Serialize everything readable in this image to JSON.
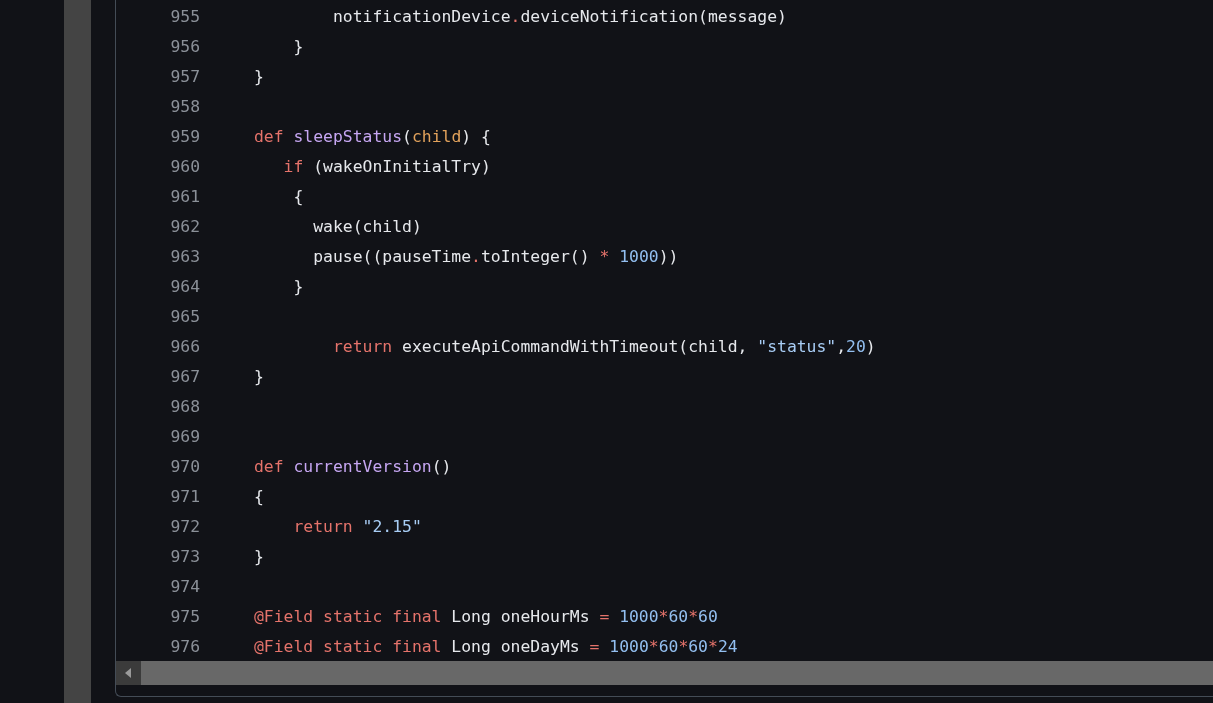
{
  "code_lines": [
    {
      "number": "955",
      "tokens": [
        {
          "kind": "plain",
          "text": "        notificationDevice"
        },
        {
          "kind": "operator",
          "text": "."
        },
        {
          "kind": "plain",
          "text": "deviceNotification(message)"
        }
      ]
    },
    {
      "number": "956",
      "tokens": [
        {
          "kind": "plain",
          "text": "    }"
        }
      ]
    },
    {
      "number": "957",
      "tokens": [
        {
          "kind": "plain",
          "text": "}"
        }
      ]
    },
    {
      "number": "958"
    },
    {
      "number": "959",
      "tokens": [
        {
          "kind": "keyword",
          "text": "def"
        },
        {
          "kind": "function",
          "text": " sleepStatus"
        },
        {
          "kind": "plain",
          "text": "("
        },
        {
          "kind": "param",
          "text": "child"
        },
        {
          "kind": "plain",
          "text": ") {"
        }
      ]
    },
    {
      "number": "960",
      "tokens": [
        {
          "kind": "keyword",
          "text": "   if"
        },
        {
          "kind": "plain",
          "text": " (wakeOnInitialTry)"
        }
      ]
    },
    {
      "number": "961",
      "tokens": [
        {
          "kind": "plain",
          "text": "    {"
        }
      ]
    },
    {
      "number": "962",
      "tokens": [
        {
          "kind": "plain",
          "text": "      wake(child)"
        }
      ]
    },
    {
      "number": "963",
      "tokens": [
        {
          "kind": "plain",
          "text": "      pause((pauseTime"
        },
        {
          "kind": "operator",
          "text": "."
        },
        {
          "kind": "plain",
          "text": "toInteger() "
        },
        {
          "kind": "operator",
          "text": "*"
        },
        {
          "kind": "number",
          "text": " 1000"
        },
        {
          "kind": "plain",
          "text": "))"
        }
      ]
    },
    {
      "number": "964",
      "tokens": [
        {
          "kind": "plain",
          "text": "    }"
        }
      ]
    },
    {
      "number": "965"
    },
    {
      "number": "966",
      "tokens": [
        {
          "kind": "keyword",
          "text": "        return"
        },
        {
          "kind": "plain",
          "text": " executeApiCommandWithTimeout(child, "
        },
        {
          "kind": "string",
          "text": "\"status\""
        },
        {
          "kind": "plain",
          "text": ","
        },
        {
          "kind": "number",
          "text": "20"
        },
        {
          "kind": "plain",
          "text": ")"
        }
      ]
    },
    {
      "number": "967",
      "tokens": [
        {
          "kind": "plain",
          "text": "}"
        }
      ]
    },
    {
      "number": "968"
    },
    {
      "number": "969"
    },
    {
      "number": "970",
      "tokens": [
        {
          "kind": "keyword",
          "text": "def"
        },
        {
          "kind": "function",
          "text": " currentVersion"
        },
        {
          "kind": "plain",
          "text": "()"
        }
      ]
    },
    {
      "number": "971",
      "tokens": [
        {
          "kind": "plain",
          "text": "{"
        }
      ]
    },
    {
      "number": "972",
      "tokens": [
        {
          "kind": "keyword",
          "text": "    return"
        },
        {
          "kind": "string",
          "text": " \"2.15\""
        }
      ]
    },
    {
      "number": "973",
      "tokens": [
        {
          "kind": "plain",
          "text": "}"
        }
      ]
    },
    {
      "number": "974"
    },
    {
      "number": "975",
      "tokens": [
        {
          "kind": "keyword",
          "text": "@Field static final"
        },
        {
          "kind": "plain",
          "text": " Long oneHourMs "
        },
        {
          "kind": "operator",
          "text": "="
        },
        {
          "kind": "number",
          "text": " 1000"
        },
        {
          "kind": "operator",
          "text": "*"
        },
        {
          "kind": "number",
          "text": "60"
        },
        {
          "kind": "operator",
          "text": "*"
        },
        {
          "kind": "number",
          "text": "60"
        }
      ]
    },
    {
      "number": "976",
      "tokens": [
        {
          "kind": "keyword",
          "text": "@Field static final"
        },
        {
          "kind": "plain",
          "text": " Long oneDayMs "
        },
        {
          "kind": "operator",
          "text": "="
        },
        {
          "kind": "number",
          "text": " 1000"
        },
        {
          "kind": "operator",
          "text": "*"
        },
        {
          "kind": "number",
          "text": "60"
        },
        {
          "kind": "operator",
          "text": "*"
        },
        {
          "kind": "number",
          "text": "60"
        },
        {
          "kind": "operator",
          "text": "*"
        },
        {
          "kind": "number",
          "text": "24"
        }
      ]
    }
  ]
}
